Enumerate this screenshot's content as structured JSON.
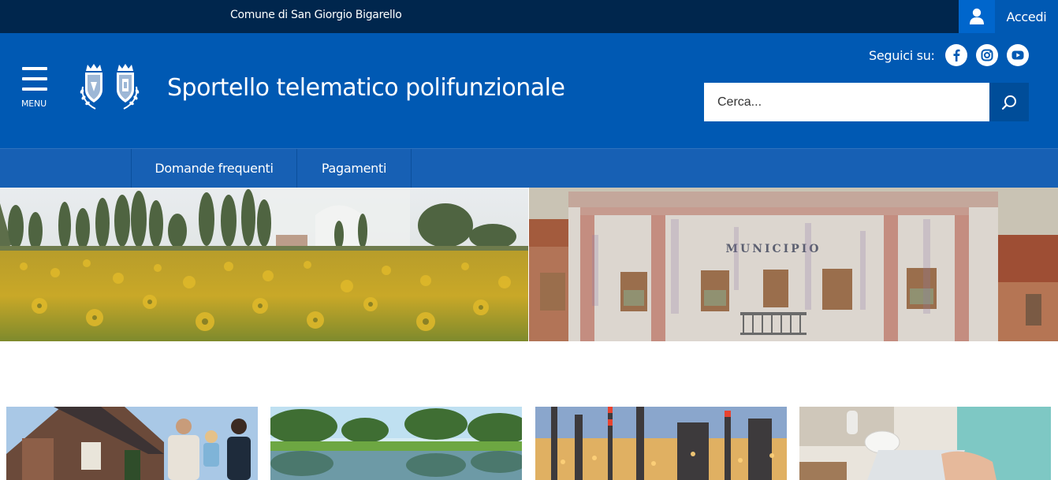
{
  "topbar": {
    "entity_name": "Comune di San Giorgio Bigarello",
    "login_label": "Accedi",
    "login_icon": "user-icon"
  },
  "header": {
    "menu_label": "MENU",
    "logo": "municipal-coats-of-arms",
    "title": "Sportello telematico polifunzionale",
    "social_label": "Seguici su:",
    "social_icons": [
      "facebook-icon",
      "instagram-icon",
      "youtube-icon"
    ],
    "search_placeholder": "Cerca...",
    "search_icon": "search-icon"
  },
  "nav": {
    "items": [
      {
        "label": "Domande frequenti"
      },
      {
        "label": "Pagamenti"
      }
    ]
  },
  "banner": {
    "left_image": "sunflower-field-with-trees-and-church",
    "right_image": "municipio-building",
    "building_sign": "MUNICIPIO"
  },
  "cards": [
    {
      "image": "family-in-front-of-house"
    },
    {
      "image": "lake-with-trees"
    },
    {
      "image": "industrial-plant"
    },
    {
      "image": "people-working-at-table"
    }
  ],
  "colors": {
    "topbar": "#00264d",
    "header": "#0059b3",
    "nav": "#1760b4",
    "accent": "#0066cc"
  }
}
